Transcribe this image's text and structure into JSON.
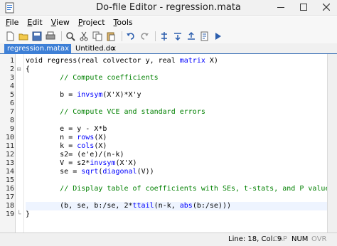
{
  "window": {
    "title": "Do-file Editor - regression.mata"
  },
  "menu": [
    {
      "label": "File",
      "accel": "F",
      "rest": "ile"
    },
    {
      "label": "Edit",
      "accel": "E",
      "rest": "dit"
    },
    {
      "label": "View",
      "accel": "V",
      "rest": "iew"
    },
    {
      "label": "Project",
      "accel": "P",
      "rest": "roject"
    },
    {
      "label": "Tools",
      "accel": "T",
      "rest": "ools"
    }
  ],
  "toolbar_icons": [
    "new-file-icon",
    "open-folder-icon",
    "save-icon",
    "print-icon",
    "find-icon",
    "cut-icon",
    "copy-icon",
    "paste-icon",
    "undo-icon",
    "redo-icon",
    "toggle-bookmark-icon",
    "next-bookmark-icon",
    "previous-bookmark-icon",
    "show-file-icon",
    "execute-icon"
  ],
  "tabs": [
    {
      "label": "regression.mata",
      "close": "x",
      "active": true
    },
    {
      "label": "Untitled.do",
      "close": "x",
      "active": false
    }
  ],
  "code": {
    "line_numbers": [
      "1",
      "2",
      "3",
      "4",
      "5",
      "6",
      "7",
      "8",
      "9",
      "10",
      "11",
      "12",
      "13",
      "14",
      "15",
      "16",
      "17",
      "18",
      "19"
    ],
    "current_line": 18
  },
  "status": {
    "position": "Line: 18, Col: 9",
    "cap": "CAP",
    "num": "NUM",
    "ovr": "OVR"
  },
  "colors": {
    "tab_active": "#3d7fd6",
    "keyword": "#0000ff",
    "comment": "#008000"
  }
}
